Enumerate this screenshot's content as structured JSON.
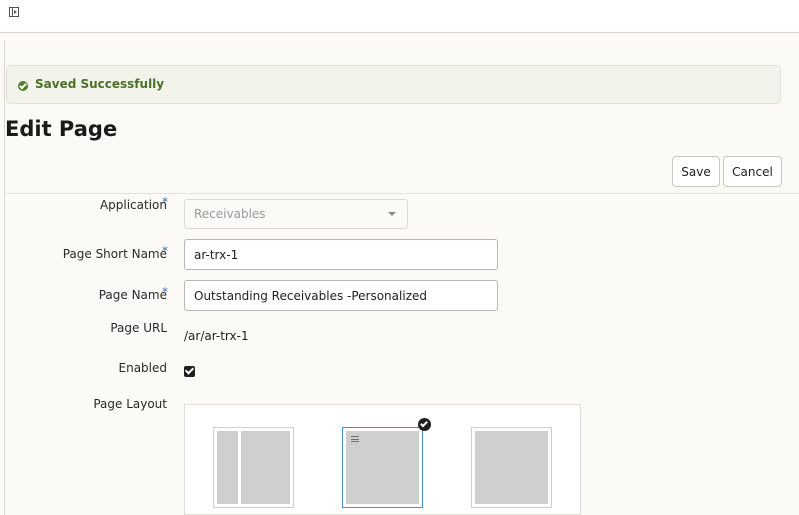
{
  "message": {
    "text": "Saved Successfully",
    "color": "#4a7026"
  },
  "page": {
    "title": "Edit Page"
  },
  "toolbar": {
    "save_label": "Save",
    "cancel_label": "Cancel"
  },
  "form": {
    "application": {
      "label": "Application",
      "required": "*",
      "value": "Receivables"
    },
    "short_name": {
      "label": "Page Short Name",
      "required": "*",
      "value": "ar-trx-1"
    },
    "page_name": {
      "label": "Page Name",
      "required": "*",
      "value": "Outstanding Receivables -Personalized"
    },
    "page_url": {
      "label": "Page URL",
      "value": "/ar/ar-trx-1"
    },
    "enabled": {
      "label": "Enabled",
      "checked": true
    },
    "page_layout": {
      "label": "Page Layout",
      "options": [
        "two-column-layout",
        "single-region-layout",
        "full-layout"
      ],
      "selected_index": 1
    }
  },
  "colors": {
    "accent": "#4a8bd0",
    "required": "#3a6fa8"
  }
}
